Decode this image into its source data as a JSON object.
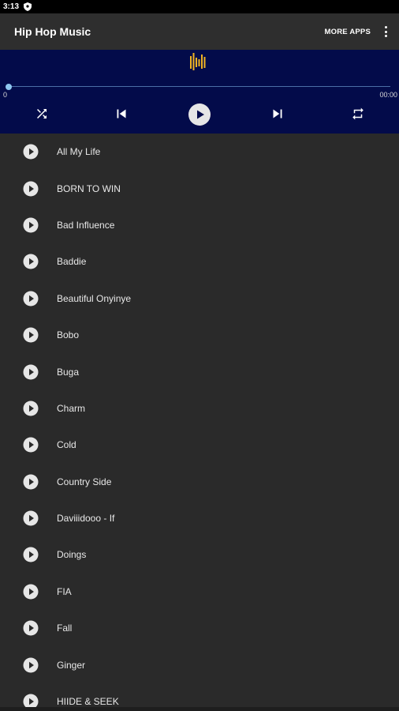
{
  "status_bar": {
    "time": "3:13"
  },
  "app_bar": {
    "title": "Hip Hop Music",
    "more_apps": "MORE APPS"
  },
  "player": {
    "elapsed": "0",
    "duration": "00:00",
    "progress": 0,
    "accent_color": "#f0b323",
    "background_color": "#030b4a",
    "controls": [
      "shuffle-icon",
      "skip-previous-icon",
      "play-icon",
      "skip-next-icon",
      "repeat-icon"
    ]
  },
  "songs": [
    {
      "title": "All My Life"
    },
    {
      "title": "BORN TO WIN"
    },
    {
      "title": "Bad Influence"
    },
    {
      "title": "Baddie"
    },
    {
      "title": "Beautiful Onyinye"
    },
    {
      "title": "Bobo"
    },
    {
      "title": "Buga"
    },
    {
      "title": "Charm"
    },
    {
      "title": "Cold"
    },
    {
      "title": "Country Side"
    },
    {
      "title": "Daviiidooo - If"
    },
    {
      "title": "Doings"
    },
    {
      "title": "FIA"
    },
    {
      "title": "Fall"
    },
    {
      "title": "Ginger"
    },
    {
      "title": "HIIDE & SEEK"
    }
  ]
}
